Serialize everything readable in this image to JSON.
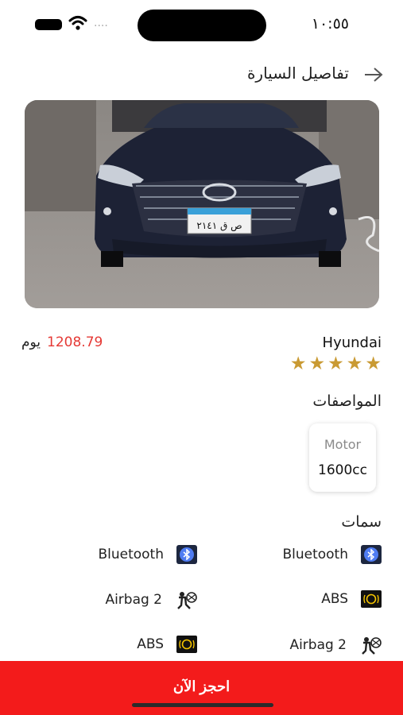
{
  "status_bar": {
    "time": "١٠:٥٥",
    "signal_dots": "....",
    "icons": [
      "battery-icon",
      "wifi-icon"
    ]
  },
  "header": {
    "title": "تفاصيل السيارة",
    "back_icon": "arrow-right-icon"
  },
  "car": {
    "image": "hyundai-car-photo",
    "plate_text": "ص ق ٢١٤١",
    "name": "Hyundai",
    "rating": 5,
    "rating_max": 5,
    "price": "1208.79",
    "price_unit": "يوم"
  },
  "specs": {
    "title": "المواصفات",
    "items": [
      {
        "label": "Motor",
        "value": "1600cc"
      }
    ]
  },
  "features": {
    "title": "سمات",
    "right_column": [
      {
        "label": "Bluetooth",
        "icon": "bluetooth-icon"
      },
      {
        "label": "ABS",
        "icon": "abs-icon"
      },
      {
        "label": "Airbag 2",
        "icon": "airbag-icon"
      }
    ],
    "left_column": [
      {
        "label": "Bluetooth",
        "icon": "bluetooth-icon"
      },
      {
        "label": "Airbag 2",
        "icon": "airbag-icon"
      },
      {
        "label": "ABS",
        "icon": "abs-icon"
      }
    ]
  },
  "actions": {
    "book_label": "احجز الآن"
  },
  "colors": {
    "accent": "#f31b1b",
    "price": "#e53935",
    "star": "#c99a33",
    "bluetooth": "#4f7cf2"
  }
}
